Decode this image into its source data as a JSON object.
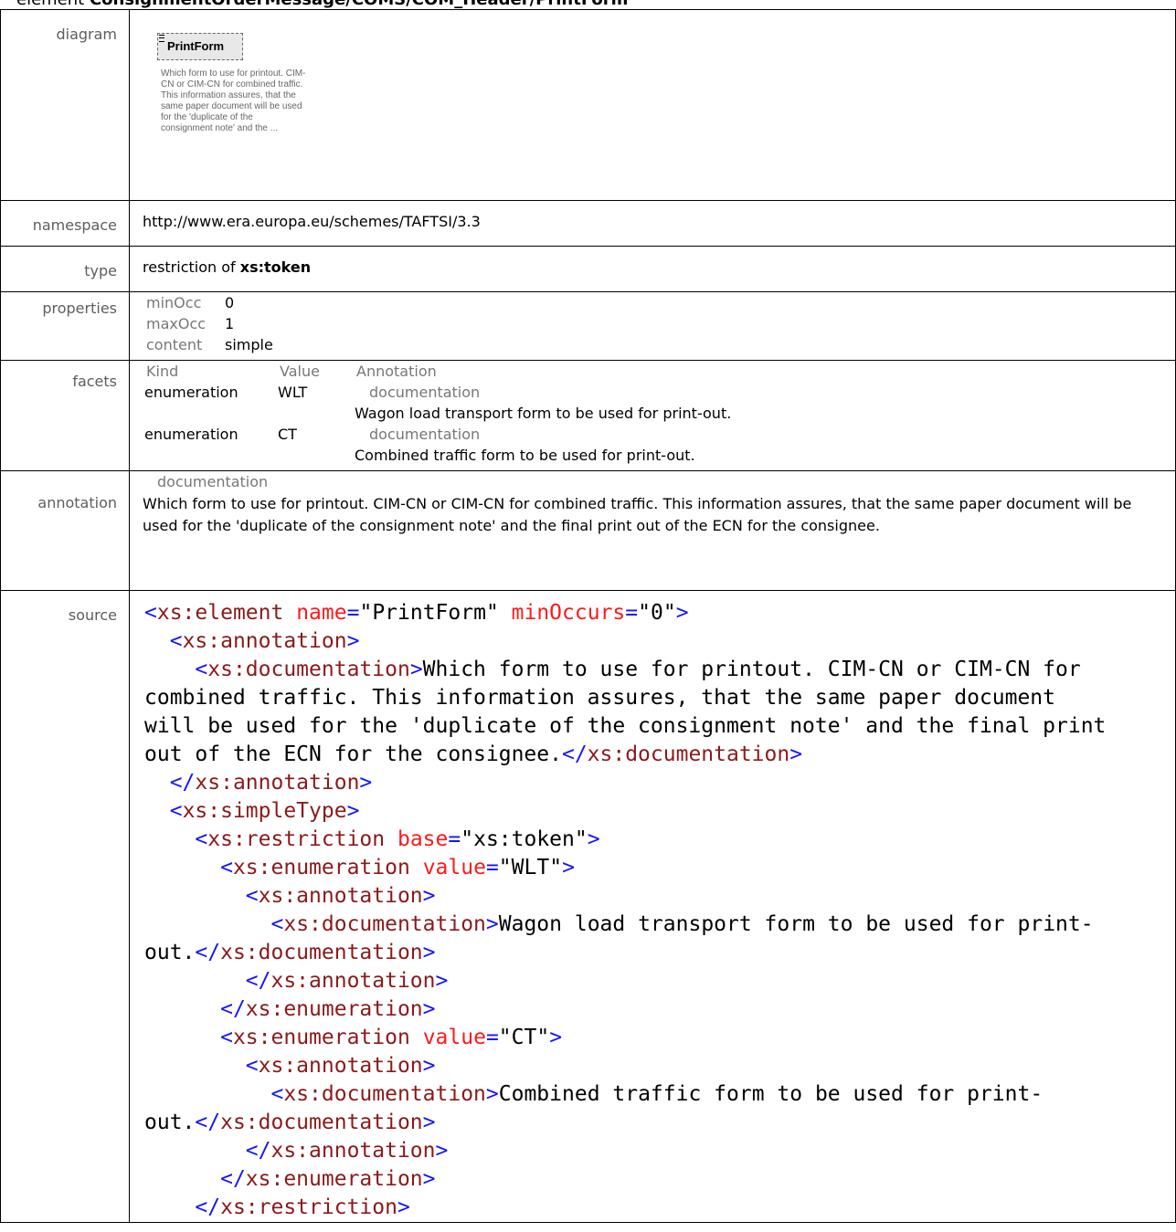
{
  "heading": {
    "prefix": "element ",
    "path": "ConsignmentOrderMessage/COMS/COM_Header/PrintForm"
  },
  "labels": {
    "diagram": "diagram",
    "namespace": "namespace",
    "type": "type",
    "properties": "properties",
    "facets": "facets",
    "annotation": "annotation",
    "source": "source"
  },
  "diagram": {
    "element_name": "PrintForm",
    "description": "Which form to use for printout. CIM-CN or CIM-CN for combined traffic. This information assures, that the same paper document will be used for the 'duplicate of the consignment note' and the ..."
  },
  "namespace": "http://www.era.europa.eu/schemes/TAFTSI/3.3",
  "type": {
    "prefix": "restriction of ",
    "base": "xs:token"
  },
  "properties": [
    {
      "key": "minOcc",
      "value": "0"
    },
    {
      "key": "maxOcc",
      "value": "1"
    },
    {
      "key": "content",
      "value": "simple"
    }
  ],
  "facets": {
    "headers": [
      "Kind",
      "Value",
      "Annotation"
    ],
    "rows": [
      {
        "kind": "enumeration",
        "value": "WLT",
        "doc_label": "documentation",
        "doc": "Wagon load transport form to be used for print-out."
      },
      {
        "kind": "enumeration",
        "value": "CT",
        "doc_label": "documentation",
        "doc": "Combined traffic form to be used for print-out."
      }
    ]
  },
  "annotation": {
    "doc_label": "documentation",
    "text": "Which form to use for printout. CIM-CN or CIM-CN for combined traffic. This information assures, that the same paper document will be used for the 'duplicate of the consignment note' and the final print out of the ECN for the consignee."
  },
  "source": {
    "element_tag": "xs:element",
    "element_name": "PrintForm",
    "min_occurs": "0",
    "annotation_tag": "xs:annotation",
    "documentation_tag": "xs:documentation",
    "doc_line1": "Which form to use for printout. CIM-CN or CIM-CN for",
    "doc_line2": "combined traffic. This information assures, that the same paper document",
    "doc_line3": "will be used for the 'duplicate of the consignment note' and the final print",
    "doc_line4": "out of the ECN for the consignee.",
    "simple_type_tag": "xs:simpleType",
    "restriction_tag": "xs:restriction",
    "restriction_base": "xs:token",
    "enumeration_tag": "xs:enumeration",
    "enum1_value": "WLT",
    "enum1_doc_a": "Wagon load transport form to be used for print-",
    "enum1_doc_b": "out.",
    "enum2_value": "CT",
    "enum2_doc_a": "Combined traffic form to be used for print-",
    "enum2_doc_b": "out."
  }
}
